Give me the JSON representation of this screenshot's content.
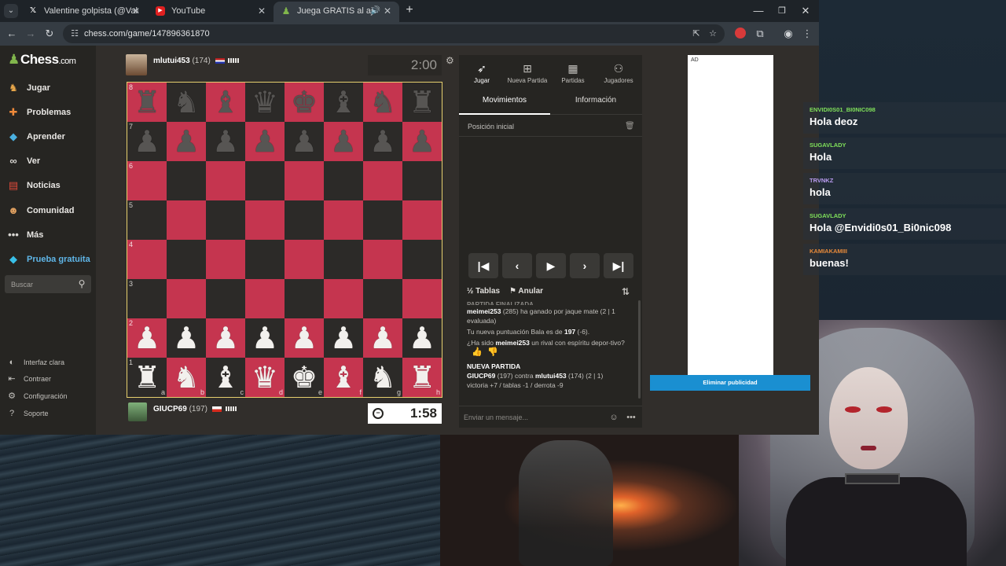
{
  "browser": {
    "tabs": [
      {
        "title": "Valentine golpista (@Valencuen",
        "icon": "x-logo-icon",
        "active": false
      },
      {
        "title": "YouTube",
        "icon": "youtube-icon",
        "active": false
      },
      {
        "title": "Juega GRATIS al ajedrez onl",
        "icon": "chess-pawn-icon",
        "active": true
      }
    ],
    "url": "chess.com/game/147896361870"
  },
  "sidebar": {
    "logo": "Chess",
    "logo_suffix": ".com",
    "items": [
      {
        "label": "Jugar",
        "icon": "play-icon"
      },
      {
        "label": "Problemas",
        "icon": "puzzle-icon"
      },
      {
        "label": "Aprender",
        "icon": "learn-icon"
      },
      {
        "label": "Ver",
        "icon": "binoculars-icon"
      },
      {
        "label": "Noticias",
        "icon": "news-icon"
      },
      {
        "label": "Comunidad",
        "icon": "community-icon"
      },
      {
        "label": "Más",
        "icon": "more-icon"
      },
      {
        "label": "Prueba gratuita",
        "icon": "diamond-icon"
      }
    ],
    "search_placeholder": "Buscar",
    "footer": [
      {
        "label": "Interfaz clara",
        "icon": "contrast-icon"
      },
      {
        "label": "Contraer",
        "icon": "collapse-icon"
      },
      {
        "label": "Configuración",
        "icon": "settings-icon"
      },
      {
        "label": "Soporte",
        "icon": "support-icon"
      }
    ]
  },
  "game": {
    "top_player": {
      "name": "mlutui453",
      "rating": "(174)"
    },
    "bottom_player": {
      "name": "GIUCP69",
      "rating": "(197)"
    },
    "top_clock": "2:00",
    "bottom_clock": "1:58",
    "board": {
      "ranks": [
        "8",
        "7",
        "6",
        "5",
        "4",
        "3",
        "2",
        "1"
      ],
      "files": [
        "a",
        "b",
        "c",
        "d",
        "e",
        "f",
        "g",
        "h"
      ],
      "position": [
        "rnbqkbnr",
        "pppppppp",
        "........",
        "........",
        "........",
        "........",
        "PPPPPPPP",
        "RNBQKBNR"
      ],
      "light_color": "#c5354f",
      "dark_color": "#2c2a28"
    }
  },
  "panel": {
    "tabs": [
      {
        "label": "Jugar",
        "icon": "rocket-icon"
      },
      {
        "label": "Nueva Partida",
        "icon": "plus-square-icon"
      },
      {
        "label": "Partidas",
        "icon": "board-icon"
      },
      {
        "label": "Jugadores",
        "icon": "users-icon"
      }
    ],
    "subtabs": [
      "Movimientos",
      "Información"
    ],
    "initial_position": "Posición inicial",
    "actions": {
      "draw": "Tablas",
      "abort": "Anular"
    },
    "log": {
      "cut_text": "PARTIDA FINALIZADA",
      "winner": "meimei253",
      "win_text": "(285) ha ganado por jaque mate (2 | 1 evaluada)",
      "rating_prefix": "Tu nueva puntuación Bala es de",
      "rating_value": "197",
      "rating_delta": "(-6).",
      "sport_prefix": "¿Ha sido",
      "sport_name": "meimei253",
      "sport_suffix": "un rival con espíritu depor-tivo?",
      "new_game_header": "NUEVA PARTIDA",
      "new_game_p1": "GIUCP69",
      "new_game_mid": "(197) contra",
      "new_game_p2": "mlutui453",
      "new_game_tail": "(174) (2 | 1)",
      "new_game_stats": "victoria +7 / tablas -1 / derrota -9"
    },
    "chat_placeholder": "Enviar un mensaje..."
  },
  "ad": {
    "label": "AD",
    "remove_label": "Eliminar publicidad"
  },
  "stream_chat": [
    {
      "user": "ENVIDI0S01_BI0NIC098",
      "text": "Hola deoz",
      "color": "#7fe05a"
    },
    {
      "user": "SUGAVLADY",
      "text": "Hola",
      "color": "#7fe05a"
    },
    {
      "user": "TRVNKZ",
      "text": "hola",
      "color": "#b99bf0"
    },
    {
      "user": "SUGAVLADY",
      "text": "Hola @Envidi0s01_Bi0nic098",
      "color": "#7fe05a"
    },
    {
      "user": "KAMIAKAMIII",
      "text": "buenas!",
      "color": "#e88a3a"
    }
  ]
}
